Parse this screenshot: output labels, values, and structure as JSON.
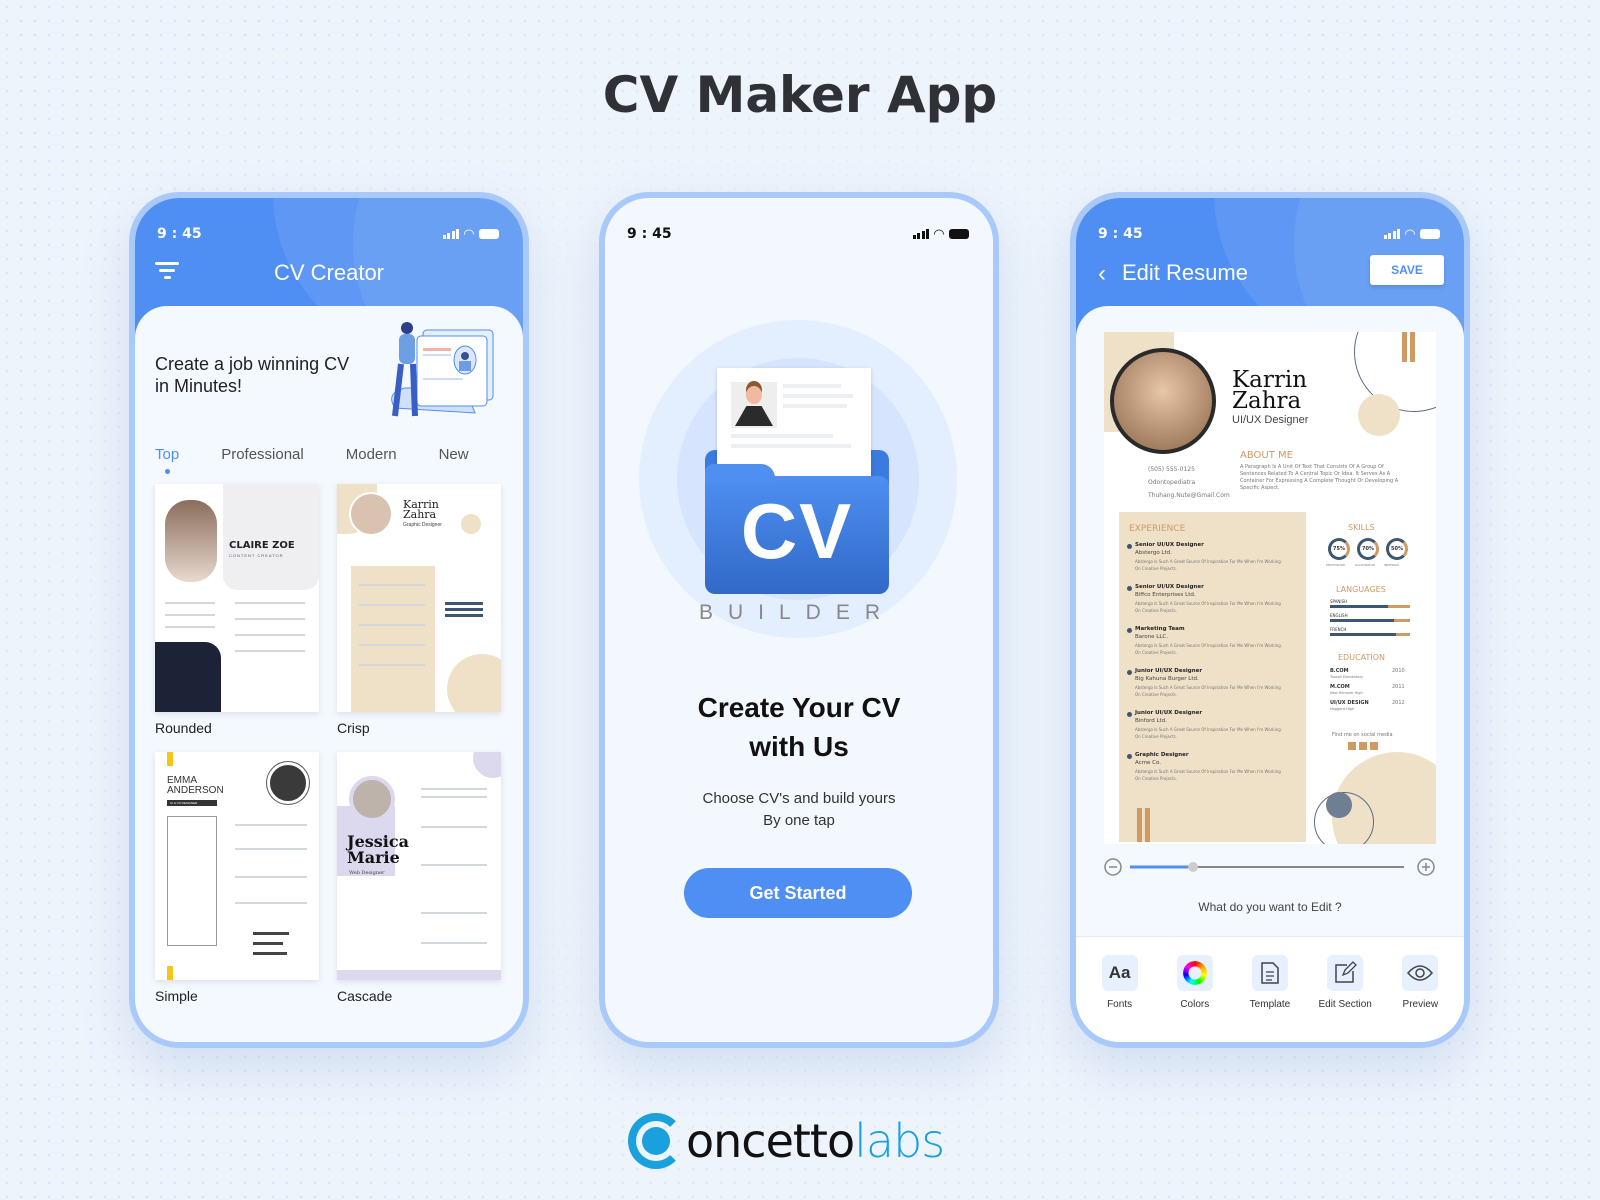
{
  "page_title": "CV Maker App",
  "status_time": "9 : 45",
  "screen1": {
    "nav_title": "CV Creator",
    "hero_text": "Create a job winning CV in Minutes!",
    "tabs": [
      {
        "label": "Top",
        "active": true
      },
      {
        "label": "Professional",
        "active": false
      },
      {
        "label": "Modern",
        "active": false
      },
      {
        "label": "New",
        "active": false
      }
    ],
    "templates": [
      {
        "label": "Rounded",
        "name": "CLAIRE ZOE",
        "role": "CONTENT CREATOR"
      },
      {
        "label": "Crisp",
        "name": "Karrin Zahra",
        "role": "Graphic Designer"
      },
      {
        "label": "Simple",
        "name": "EMMA ANDERSON",
        "role": "UI & UX DESIGNER"
      },
      {
        "label": "Cascade",
        "name": "Jessica Marie",
        "role": "Web Designer"
      }
    ]
  },
  "screen2": {
    "logo_main": "CV",
    "logo_sub": "BUILDER",
    "heading": "Create Your CV with Us",
    "subtext_1": "Choose CV's and build yours",
    "subtext_2": "By one tap",
    "cta_label": "Get Started"
  },
  "screen3": {
    "nav_title": "Edit Resume",
    "save_label": "SAVE",
    "resume": {
      "first_name": "Karrin",
      "last_name": "Zahra",
      "role": "UI/UX Designer",
      "phone": "(505) 555-0125",
      "location": "Odontopediatra",
      "email": "Thuhang.Nute@Gmail.Com",
      "about_title": "ABOUT ME",
      "about_text": "A Paragraph Is A Unit Of Text That Consists Of A Group Of Sentences Related To A Central Topic Or Idea. It Serves As A Container For Expressing A Complete Thought Or Developing A Specific Aspect.",
      "experience_title": "EXPERIENCE",
      "experience": [
        {
          "title": "Senior UI/UX Designer",
          "company": "Abstergo Ltd."
        },
        {
          "title": "Senior UI/UX Designer",
          "company": "Biffco Enterprises Ltd."
        },
        {
          "title": "Marketing Team",
          "company": "Barone LLC."
        },
        {
          "title": "Junior UI/UX Designer",
          "company": "Big Kahuna Burger Ltd."
        },
        {
          "title": "Junior UI/UX Designer",
          "company": "Binford Ltd."
        },
        {
          "title": "Graphic Designer",
          "company": "Acme Co."
        }
      ],
      "experience_desc": "Abstergo Is Such A Great Source Of Inspiration For Me When I'm Working On Creative Projects.",
      "skills_title": "SKILLS",
      "skills": [
        {
          "name": "PHOTOSHOP",
          "value": "75%"
        },
        {
          "name": "ILLUSTRATOR",
          "value": "70%"
        },
        {
          "name": "INDESIGN",
          "value": "50%"
        }
      ],
      "languages_title": "LANGUAGES",
      "languages": [
        {
          "name": "SPANISH",
          "level": 0.72
        },
        {
          "name": "ENGLISH",
          "level": 0.8
        },
        {
          "name": "FRENCH",
          "level": 0.82
        }
      ],
      "education_title": "EDUCATION",
      "education": [
        {
          "degree": "B.COM",
          "school": "Topsail Elementary",
          "year": "2010"
        },
        {
          "degree": "M.COM",
          "school": "New Hanover High",
          "year": "2011"
        },
        {
          "degree": "UI/UX DESIGN",
          "school": "Hoggard High",
          "year": "2012"
        }
      ],
      "social_text": "Find me on social media"
    },
    "zoom_level": 0.23,
    "edit_prompt": "What do you want to Edit ?",
    "tools": [
      {
        "label": "Fonts",
        "icon": "font-icon",
        "glyph": "Aa"
      },
      {
        "label": "Colors",
        "icon": "color-wheel-icon",
        "glyph": ""
      },
      {
        "label": "Template",
        "icon": "document-icon",
        "glyph": ""
      },
      {
        "label": "Edit Section",
        "icon": "edit-icon",
        "glyph": ""
      },
      {
        "label": "Preview",
        "icon": "eye-icon",
        "glyph": ""
      }
    ]
  },
  "footer_logo": {
    "part1": "oncetto",
    "part2": "labs"
  }
}
